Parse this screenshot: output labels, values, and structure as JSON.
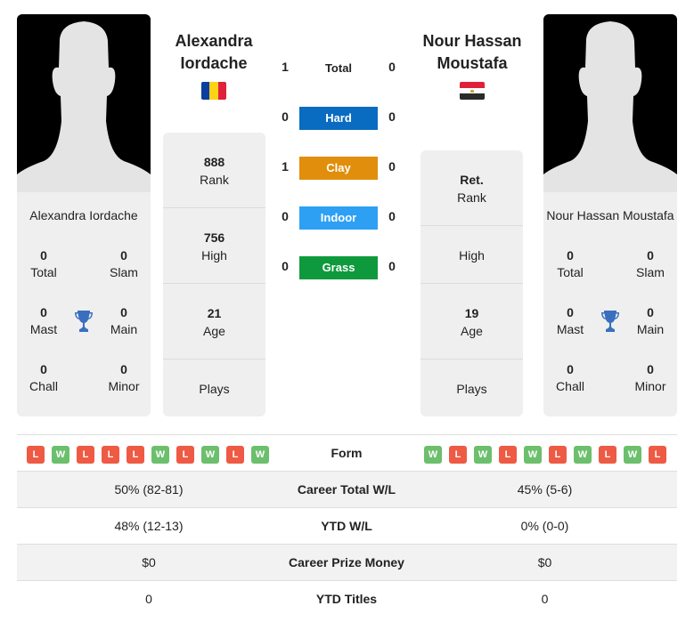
{
  "colors": {
    "hard": "#0a6cc0",
    "clay": "#e08e0b",
    "indoor": "#2ea0f4",
    "grass": "#0e9a3c",
    "win": "#6cbf6c",
    "loss": "#ee5a43",
    "trophy": "#3a6fc0"
  },
  "player1": {
    "name": "Alexandra Iordache",
    "name_line1": "Alexandra",
    "name_line2": "Iordache",
    "flag": "romania-flag",
    "titles": {
      "total": {
        "value": "0",
        "label": "Total"
      },
      "slam": {
        "value": "0",
        "label": "Slam"
      },
      "mast": {
        "value": "0",
        "label": "Mast"
      },
      "main": {
        "value": "0",
        "label": "Main"
      },
      "chall": {
        "value": "0",
        "label": "Chall"
      },
      "minor": {
        "value": "0",
        "label": "Minor"
      }
    },
    "stats": {
      "rank": {
        "value": "888",
        "label": "Rank"
      },
      "high": {
        "value": "756",
        "label": "High"
      },
      "age": {
        "value": "21",
        "label": "Age"
      },
      "plays": {
        "value": "",
        "label": "Plays"
      }
    },
    "form": [
      "L",
      "W",
      "L",
      "L",
      "L",
      "W",
      "L",
      "W",
      "L",
      "W"
    ]
  },
  "player2": {
    "name": "Nour Hassan Moustafa",
    "name_line1": "Nour Hassan",
    "name_line2": "Moustafa",
    "flag": "egypt-flag",
    "titles": {
      "total": {
        "value": "0",
        "label": "Total"
      },
      "slam": {
        "value": "0",
        "label": "Slam"
      },
      "mast": {
        "value": "0",
        "label": "Mast"
      },
      "main": {
        "value": "0",
        "label": "Main"
      },
      "chall": {
        "value": "0",
        "label": "Chall"
      },
      "minor": {
        "value": "0",
        "label": "Minor"
      }
    },
    "stats": {
      "rank": {
        "value": "Ret.",
        "label": "Rank"
      },
      "high": {
        "value": "",
        "label": "High"
      },
      "age": {
        "value": "19",
        "label": "Age"
      },
      "plays": {
        "value": "",
        "label": "Plays"
      }
    },
    "form": [
      "W",
      "L",
      "W",
      "L",
      "W",
      "L",
      "W",
      "L",
      "W",
      "L"
    ]
  },
  "h2h": {
    "total": {
      "label": "Total",
      "p1": "1",
      "p2": "0"
    },
    "surfaces": [
      {
        "key": "hard",
        "label": "Hard",
        "p1": "0",
        "p2": "0"
      },
      {
        "key": "clay",
        "label": "Clay",
        "p1": "1",
        "p2": "0"
      },
      {
        "key": "indoor",
        "label": "Indoor",
        "p1": "0",
        "p2": "0"
      },
      {
        "key": "grass",
        "label": "Grass",
        "p1": "0",
        "p2": "0"
      }
    ]
  },
  "table": {
    "form_label": "Form",
    "rows": [
      {
        "label": "Career Total W/L",
        "p1": "50% (82-81)",
        "p2": "45% (5-6)"
      },
      {
        "label": "YTD W/L",
        "p1": "48% (12-13)",
        "p2": "0% (0-0)"
      },
      {
        "label": "Career Prize Money",
        "p1": "$0",
        "p2": "$0"
      },
      {
        "label": "YTD Titles",
        "p1": "0",
        "p2": "0"
      }
    ]
  }
}
